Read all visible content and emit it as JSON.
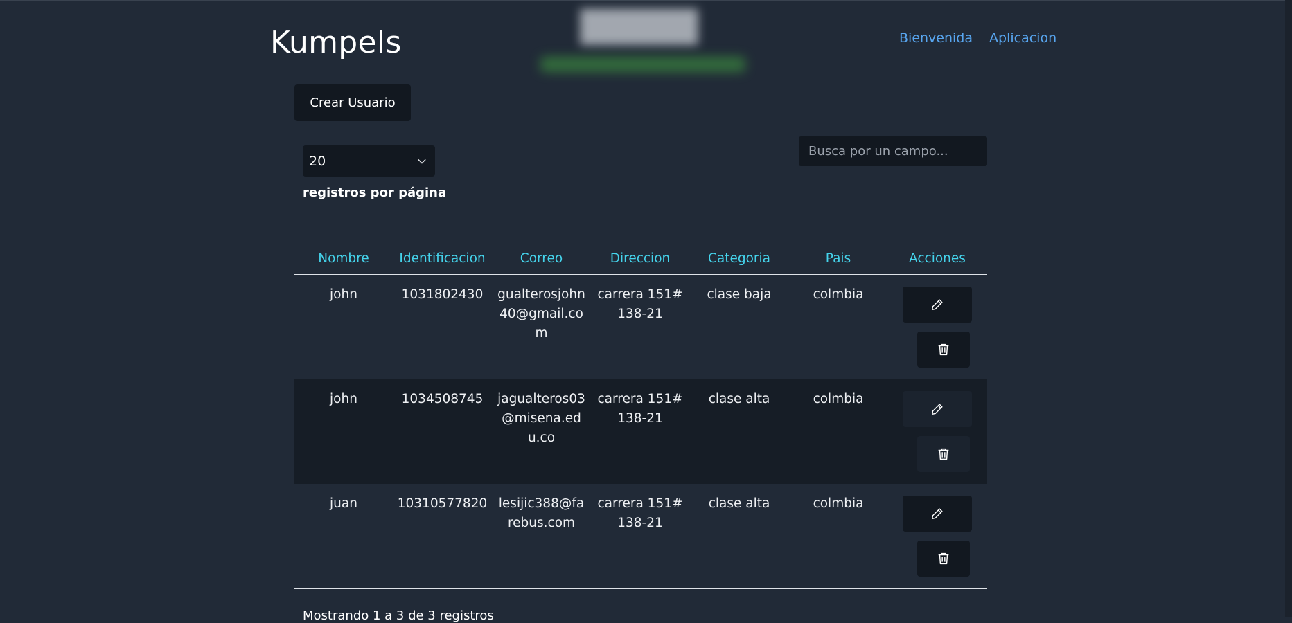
{
  "header": {
    "brand": "Kumpels",
    "nav": [
      "Bienvenida",
      "Aplicacion"
    ]
  },
  "toolbar": {
    "create_label": "Crear Usuario",
    "page_size": "20",
    "per_page_label": "registros por página",
    "search_placeholder": "Busca por un campo..."
  },
  "table": {
    "headers": [
      "Nombre",
      "Identificacion",
      "Correo",
      "Direccion",
      "Categoria",
      "Pais",
      "Acciones"
    ],
    "rows": [
      {
        "nombre": "john",
        "identificacion": "1031802430",
        "correo": "gualterosjohn40@gmail.com",
        "direccion": "carrera 151#138-21",
        "categoria": "clase baja",
        "pais": "colmbia"
      },
      {
        "nombre": "john",
        "identificacion": "1034508745",
        "correo": "jagualteros03@misena.edu.co",
        "direccion": "carrera 151#138-21",
        "categoria": "clase alta",
        "pais": "colmbia"
      },
      {
        "nombre": "juan",
        "identificacion": "10310577820",
        "correo": "lesijic388@farebus.com",
        "direccion": "carrera 151#138-21",
        "categoria": "clase alta",
        "pais": "colmbia"
      }
    ]
  },
  "footer": {
    "info": "Mostrando 1 a 3 de 3 registros"
  },
  "colors": {
    "background": "#212a37",
    "header_accent": "#45d4ec",
    "link": "#58a6f0",
    "button_bg": "#121820"
  },
  "icons": [
    "chevron-down-icon",
    "pencil-icon",
    "trash-icon"
  ]
}
